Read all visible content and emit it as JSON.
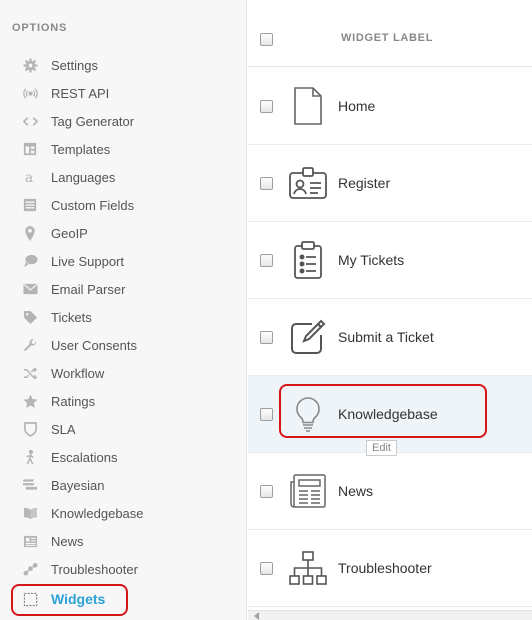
{
  "sidebar": {
    "title": "OPTIONS",
    "items": [
      {
        "label": "Settings",
        "icon": "gear-icon"
      },
      {
        "label": "REST API",
        "icon": "broadcast-icon"
      },
      {
        "label": "Tag Generator",
        "icon": "code-icon"
      },
      {
        "label": "Templates",
        "icon": "template-icon"
      },
      {
        "label": "Languages",
        "icon": "language-icon"
      },
      {
        "label": "Custom Fields",
        "icon": "list-icon"
      },
      {
        "label": "GeoIP",
        "icon": "map-pin-icon"
      },
      {
        "label": "Live Support",
        "icon": "chat-icon"
      },
      {
        "label": "Email Parser",
        "icon": "envelope-icon"
      },
      {
        "label": "Tickets",
        "icon": "tag-icon"
      },
      {
        "label": "User Consents",
        "icon": "wrench-icon"
      },
      {
        "label": "Workflow",
        "icon": "shuffle-icon"
      },
      {
        "label": "Ratings",
        "icon": "star-icon"
      },
      {
        "label": "SLA",
        "icon": "shield-icon"
      },
      {
        "label": "Escalations",
        "icon": "escalation-icon"
      },
      {
        "label": "Bayesian",
        "icon": "bayesian-icon"
      },
      {
        "label": "Knowledgebase",
        "icon": "book-icon"
      },
      {
        "label": "News",
        "icon": "newspaper-icon"
      },
      {
        "label": "Troubleshooter",
        "icon": "flow-icon"
      },
      {
        "label": "Widgets",
        "icon": "widget-icon",
        "active": true
      }
    ]
  },
  "table": {
    "header_label": "WIDGET LABEL",
    "rows": [
      {
        "label": "Home",
        "icon": "page-icon"
      },
      {
        "label": "Register",
        "icon": "id-card-icon"
      },
      {
        "label": "My Tickets",
        "icon": "clipboard-icon"
      },
      {
        "label": "Submit a Ticket",
        "icon": "pencil-square-icon"
      },
      {
        "label": "Knowledgebase",
        "icon": "lightbulb-icon",
        "hover": true
      },
      {
        "label": "News",
        "icon": "newspaper-icon"
      },
      {
        "label": "Troubleshooter",
        "icon": "org-chart-icon"
      }
    ],
    "tooltip": "Edit"
  },
  "colors": {
    "accent": "#2da2d6",
    "highlight": "#d6151b"
  }
}
